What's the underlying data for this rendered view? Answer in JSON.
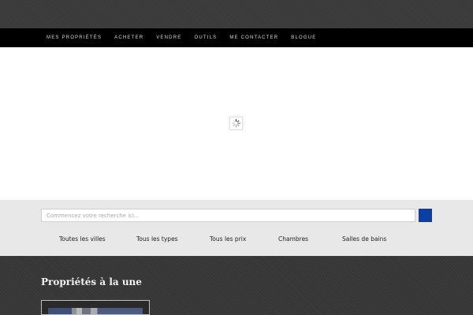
{
  "nav": {
    "items": [
      "Mes propriétés",
      "Acheter",
      "Vendre",
      "Outils",
      "Me contacter",
      "Blogue"
    ]
  },
  "search": {
    "placeholder": "Commencez votre recherche ici...",
    "button_icon": "search-icon",
    "button_color": "#0b3fa3"
  },
  "filters": [
    "Toutes les villes",
    "Tous les types",
    "Tous les prix",
    "Chambres",
    "Salles de bains"
  ],
  "featured": {
    "title": "Propriétés à la une"
  },
  "hero": {
    "icon": "loading-spinner-icon"
  }
}
